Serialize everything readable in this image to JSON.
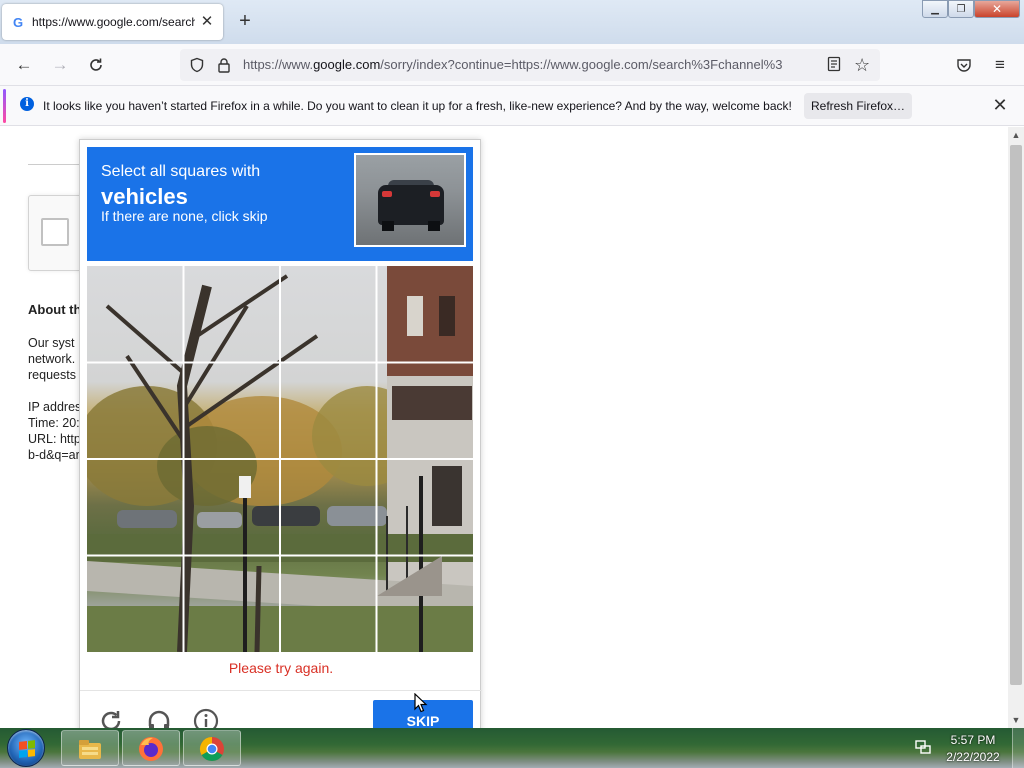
{
  "browser": {
    "tab": {
      "title": "https://www.google.com/search?channel",
      "favicon": "google-g-icon"
    },
    "url": {
      "prefix": "https://www.",
      "domain": "google.com",
      "rest": "/sorry/index?continue=https://www.google.com/search%3Fchannel%3"
    },
    "icons": [
      "back-arrow-icon",
      "forward-arrow-icon",
      "reload-icon",
      "shield-icon",
      "lock-icon",
      "reader-view-icon",
      "star-bookmark-icon",
      "pocket-icon",
      "hamburger-menu-icon"
    ]
  },
  "notification": {
    "text": "It looks like you haven’t started Firefox in a while. Do you want to clean it up for a fresh, like-new experience? And by the way, welcome back!",
    "button": "Refresh Firefox…"
  },
  "page": {
    "heading": "About th",
    "lines": [
      "Our syst",
      "network.",
      "requests",
      "IP addres",
      "Time: 20:",
      "URL: http",
      "b-d&q=ar"
    ]
  },
  "captcha": {
    "header": {
      "line1": "Select all squares with",
      "line2": "vehicles",
      "line3": "If there are none, click skip"
    },
    "grid": {
      "rows": 4,
      "cols": 4
    },
    "error": "Please try again.",
    "skip_label": "SKIP",
    "footer_icons": [
      "reload-icon",
      "headphones-icon",
      "info-icon"
    ],
    "colors": {
      "accent": "#1a73e8",
      "error": "#d93025"
    }
  },
  "taskbar": {
    "apps": [
      "windows-explorer-icon",
      "firefox-icon",
      "chrome-icon"
    ],
    "time": "5:57 PM",
    "date": "2/22/2022"
  }
}
